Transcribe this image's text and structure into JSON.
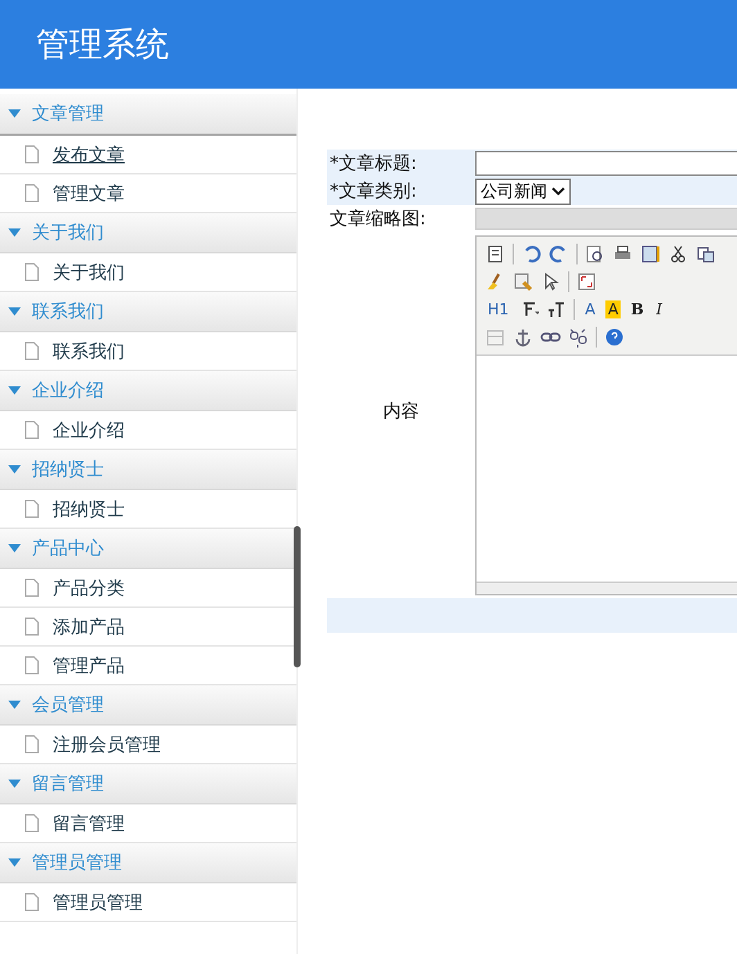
{
  "header": {
    "title": "管理系统"
  },
  "sidebar": {
    "groups": [
      {
        "title": "文章管理",
        "expanded": true,
        "items": [
          {
            "label": "发布文章",
            "selected": true
          },
          {
            "label": "管理文章",
            "selected": false
          }
        ]
      },
      {
        "title": "关于我们",
        "expanded": true,
        "items": [
          {
            "label": "关于我们",
            "selected": false
          }
        ]
      },
      {
        "title": "联系我们",
        "expanded": true,
        "items": [
          {
            "label": "联系我们",
            "selected": false
          }
        ]
      },
      {
        "title": "企业介绍",
        "expanded": true,
        "items": [
          {
            "label": "企业介绍",
            "selected": false
          }
        ]
      },
      {
        "title": "招纳贤士",
        "expanded": true,
        "items": [
          {
            "label": "招纳贤士",
            "selected": false
          }
        ]
      },
      {
        "title": "产品中心",
        "expanded": true,
        "items": [
          {
            "label": "产品分类",
            "selected": false
          },
          {
            "label": "添加产品",
            "selected": false
          },
          {
            "label": "管理产品",
            "selected": false
          }
        ]
      },
      {
        "title": "会员管理",
        "expanded": true,
        "items": [
          {
            "label": "注册会员管理",
            "selected": false
          }
        ]
      },
      {
        "title": "留言管理",
        "expanded": true,
        "items": [
          {
            "label": "留言管理",
            "selected": false
          }
        ]
      },
      {
        "title": "管理员管理",
        "expanded": true,
        "items": [
          {
            "label": "管理员管理",
            "selected": false
          }
        ]
      }
    ]
  },
  "form": {
    "title_label": "*文章标题:",
    "category_label": "*文章类别:",
    "category_value": "公司新闻",
    "thumbnail_label": "文章缩略图:",
    "content_label": "内容",
    "toolbar_rows": [
      [
        {
          "kind": "icon"
        },
        {
          "kind": "sep"
        },
        {
          "kind": "icon"
        },
        {
          "kind": "icon"
        },
        {
          "kind": "sep"
        },
        {
          "kind": "icon"
        },
        {
          "kind": "icon"
        },
        {
          "kind": "icon"
        },
        {
          "kind": "icon"
        },
        {
          "kind": "icon"
        }
      ],
      [
        {
          "kind": "icon"
        },
        {
          "kind": "icon"
        },
        {
          "kind": "icon"
        },
        {
          "kind": "sep"
        },
        {
          "kind": "icon"
        }
      ],
      [
        {
          "kind": "text",
          "label": "H1"
        },
        {
          "kind": "icon"
        },
        {
          "kind": "icon"
        },
        {
          "kind": "sep"
        },
        {
          "kind": "text",
          "label": "A"
        },
        {
          "kind": "highlight",
          "label": "A"
        },
        {
          "kind": "bold",
          "label": "B"
        },
        {
          "kind": "italic",
          "label": "I"
        }
      ],
      [
        {
          "kind": "icon"
        },
        {
          "kind": "icon"
        },
        {
          "kind": "icon"
        },
        {
          "kind": "icon"
        },
        {
          "kind": "sep"
        },
        {
          "kind": "icon"
        }
      ]
    ]
  }
}
